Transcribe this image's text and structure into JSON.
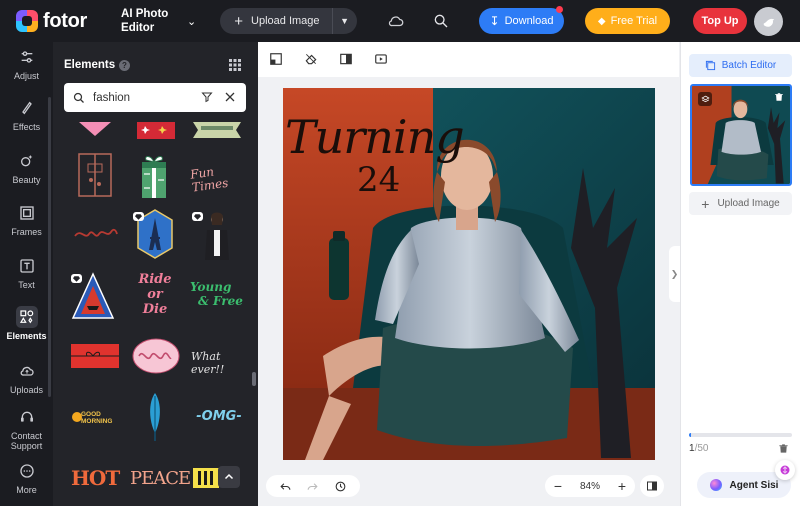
{
  "header": {
    "logo_text": "fotor",
    "app_name": "AI Photo Editor",
    "upload_label": "Upload Image",
    "download_label": "Download",
    "free_trial_label": "Free Trial",
    "top_up_label": "Top Up"
  },
  "rail": {
    "items": [
      {
        "label": "Adjust"
      },
      {
        "label": "Effects"
      },
      {
        "label": "Beauty"
      },
      {
        "label": "Frames"
      },
      {
        "label": "Text"
      },
      {
        "label": "Elements"
      },
      {
        "label": "Uploads"
      },
      {
        "label": "Contact Support"
      },
      {
        "label": "More"
      }
    ],
    "active": "Elements"
  },
  "elements_panel": {
    "title": "Elements",
    "search_value": "fashion",
    "stickers": [
      "pink heart sticker",
      "red gift bow sticker",
      "ribbon banner sticker",
      "gift box outline sticker",
      "green gift box sticker",
      "Fun Times sticker",
      "red script sticker",
      "Eiffel tower hexagon sticker",
      "fashion woman sticker",
      "volcano triangle sticker",
      "Ride or Die sticker",
      "Young & Free sticker",
      "red gift card sticker",
      "pink doodle oval sticker",
      "What ever sticker",
      "Good Morning sticker",
      "feather sticker",
      "OMG sticker",
      "HOT sticker",
      "PEACE sticker",
      "gold stripes sticker"
    ],
    "sticker_text": {
      "fun_times": "Fun Times",
      "ride_or_die_1": "Ride",
      "ride_or_die_2": "or",
      "ride_or_die_3": "Die",
      "young_free_1": "Young",
      "young_free_2": "& Free",
      "whatever": "What ever!!",
      "good_morning": "GOOD MORNING",
      "omg": "-OMG-",
      "hot": "HOT",
      "peace": "PEACE"
    }
  },
  "canvas": {
    "title_line1": "Turning",
    "title_line2": "24",
    "zoom": "84%"
  },
  "right_panel": {
    "batch_editor_label": "Batch Editor",
    "upload_image_label": "Upload Image",
    "count_current": "1",
    "count_total": "/50",
    "progress": 0.02,
    "agent_label": "Agent Sisi"
  },
  "colors": {
    "accent_blue": "#2d7cf6",
    "trial_orange": "#ffae1a",
    "topup_red": "#e8333c",
    "dark_bg": "#1b1c21"
  }
}
